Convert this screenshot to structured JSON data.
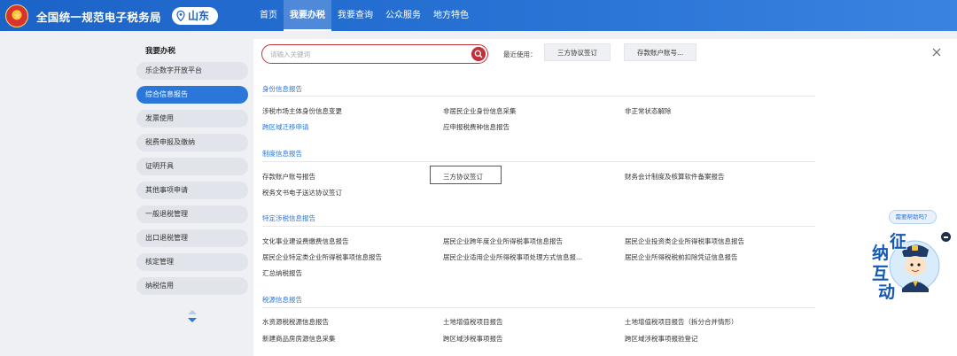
{
  "header": {
    "site_title": "全国统一规范电子税务局",
    "region": "山东",
    "nav": [
      "首页",
      "我要办税",
      "我要查询",
      "公众服务",
      "地方特色"
    ],
    "active_nav": "我要办税"
  },
  "sidebar": {
    "title": "我要办税",
    "items": [
      "乐企数字开放平台",
      "综合信息报告",
      "发票使用",
      "税费申报及缴纳",
      "证明开具",
      "其他事项申请",
      "一般退税管理",
      "出口退税管理",
      "核定管理",
      "纳税信用"
    ],
    "active_item": "综合信息报告"
  },
  "search": {
    "placeholder": "请输入关键词",
    "recent_label": "最近使用：",
    "recent": [
      "三方协议签订",
      "存款账户账号..."
    ]
  },
  "sections": [
    {
      "title": "身份信息报告",
      "links": [
        "涉税市场主体身份信息变更",
        "非居民企业身份信息采集",
        "非正常状态解除",
        "跨区域迁移申请",
        "应申报税费种信息报告"
      ]
    },
    {
      "title": "制度信息报告",
      "links": [
        "存款账户账号报告",
        "三方协议签订",
        "财务会计制度及核算软件备案报告",
        "税务文书电子送达协议签订"
      ]
    },
    {
      "title": "特定涉税信息报告",
      "links": [
        "文化事业建设费缴费信息报告",
        "居民企业跨年度企业所得税事项信息报告",
        "居民企业投资类企业所得税事项信息报告",
        "居民企业特定类企业所得税事项信息报告",
        "居民企业适用企业所得税事项处理方式信息报...",
        "居民企业所得税税前扣除凭证信息报告",
        "汇总纳税报告"
      ]
    },
    {
      "title": "税源信息报告",
      "links": [
        "水资源税税源信息报告",
        "土地增值税项目报告",
        "土地增值税项目报告（拆分合并情形）",
        "新建商品房房源信息采集",
        "跨区域涉税事项报告",
        "跨区域涉税事项报验登记"
      ]
    }
  ],
  "helper": {
    "bubble": "需要帮助吗？",
    "mascot_chars": [
      "征",
      "纳",
      "互",
      "动"
    ]
  },
  "colors": {
    "header_blue": "#1c63c8",
    "link_blue": "#2b77d9",
    "search_red": "#c3303a",
    "highlight_red": "#d1222a"
  }
}
